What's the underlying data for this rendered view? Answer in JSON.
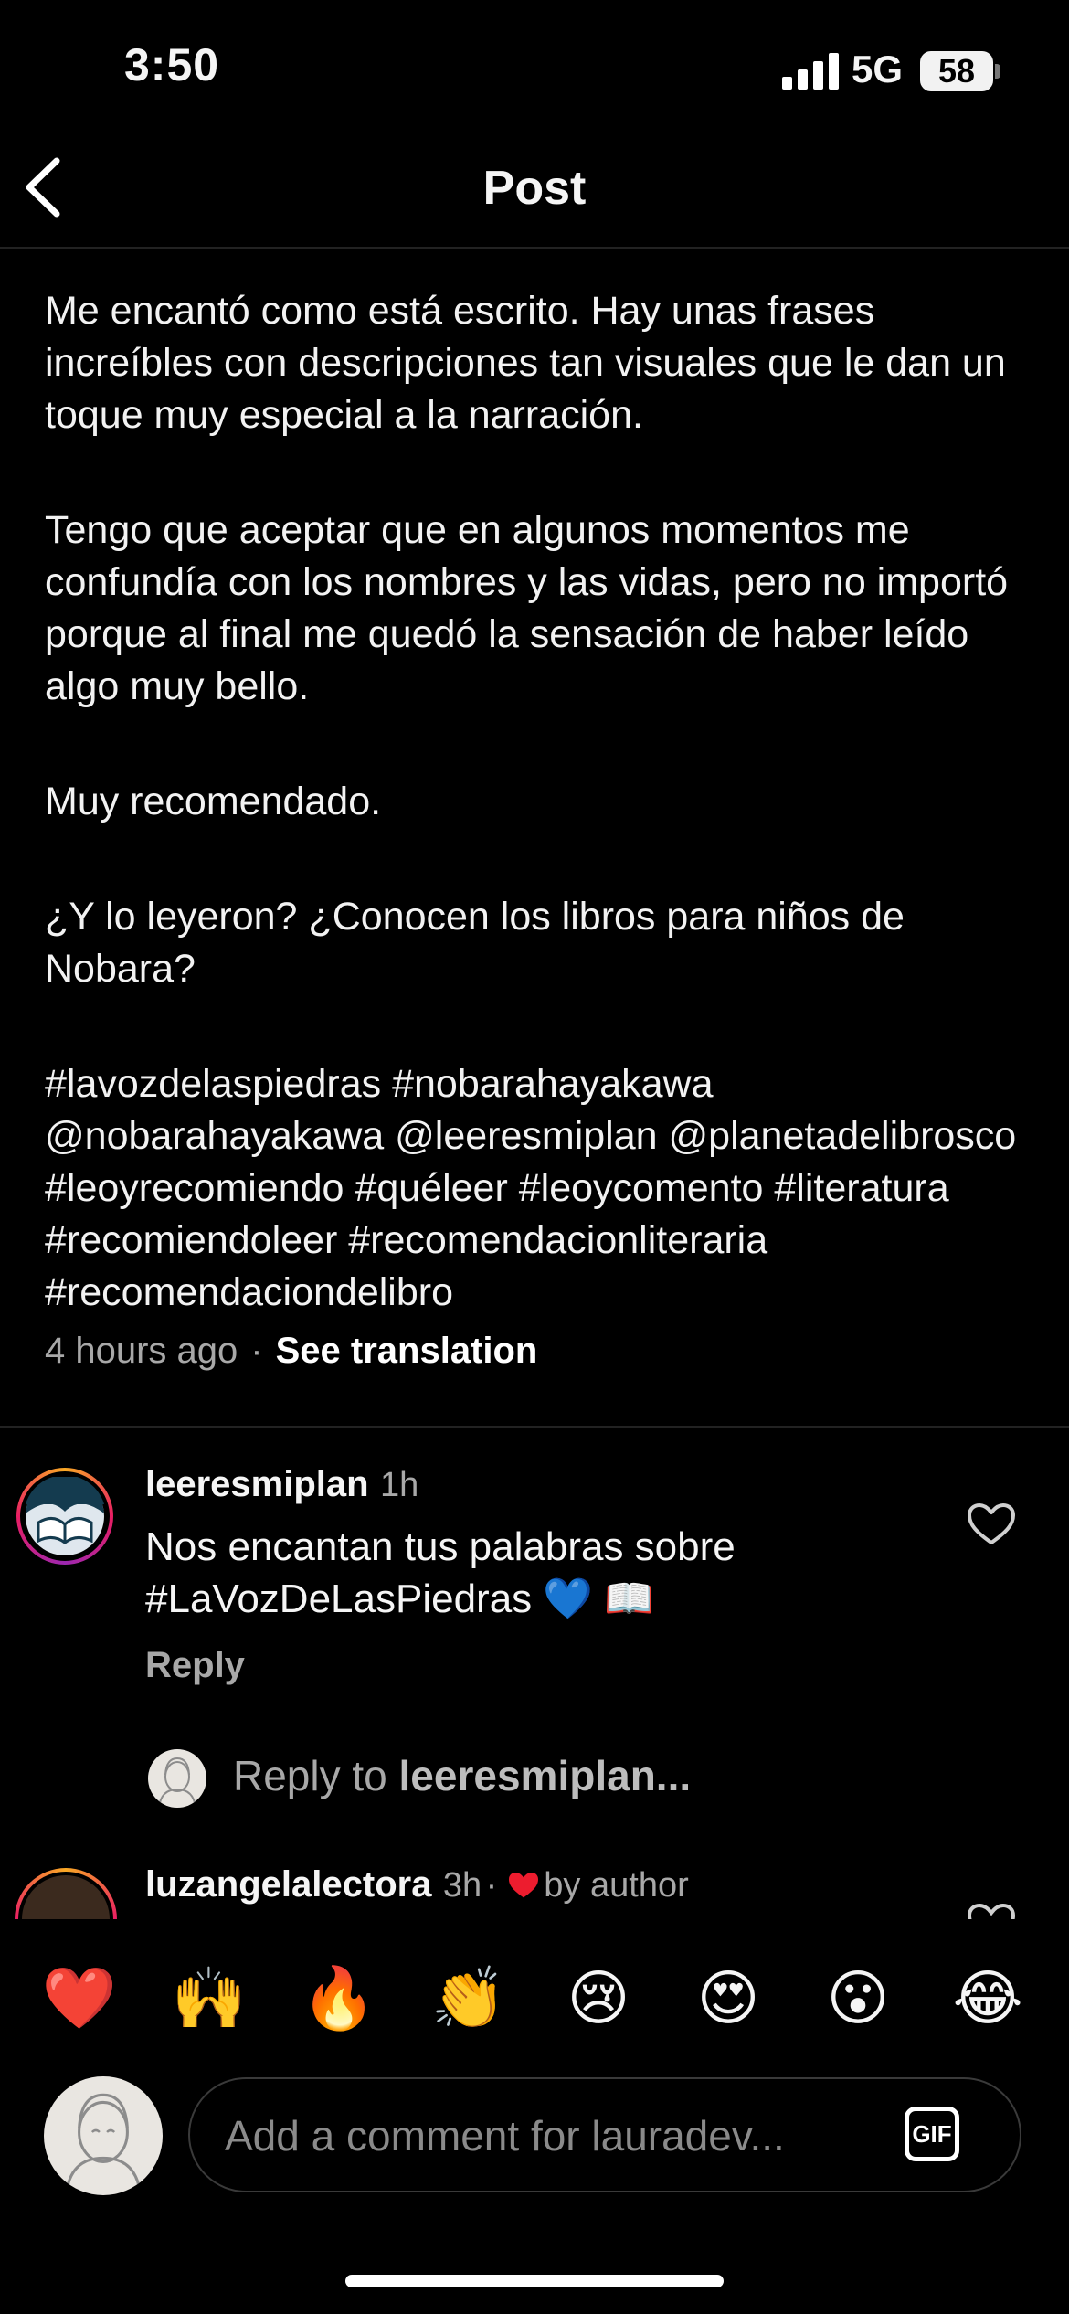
{
  "status_bar": {
    "time": "3:50",
    "network": "5G",
    "battery": "58"
  },
  "nav": {
    "title": "Post"
  },
  "caption": {
    "paragraphs": [
      "Me encantó como está escrito. Hay unas frases increíbles con descripciones tan visuales que le dan un toque muy especial a la narración.",
      "Tengo que aceptar que en algunos momentos me confundía con los nombres y las vidas, pero no importó porque al final me quedó la sensación de haber leído algo muy bello.",
      "Muy recomendado.",
      "¿Y lo leyeron? ¿Conocen los libros para niños de Nobara?"
    ],
    "tags": "#lavozdelaspiedras #nobarahayakawa @nobarahayakawa @leeresmiplan @planetadelibrosco #leoyrecomiendo #quéleer #leoycomento #literatura #recomiendoleer #recomendacionliteraria #recomendaciondelibro",
    "timestamp": "4 hours ago",
    "see_translation": "See translation"
  },
  "comments": [
    {
      "username": "leeresmiplan",
      "time": "1h",
      "text": "Nos encantan tus palabras sobre #LaVozDeLasPiedras 💙 📖",
      "reply_label": "Reply"
    },
    {
      "username": "luzangelalectora",
      "time": "3h",
      "by_author": "by author"
    }
  ],
  "reply_prompt": {
    "prefix": "Reply to ",
    "target": "leeresmiplan..."
  },
  "emoji_bar": [
    "❤️",
    "🙌",
    "🔥",
    "👏",
    "😢",
    "😍",
    "😮",
    "😂"
  ],
  "comment_input": {
    "placeholder": "Add a comment for lauradev...",
    "gif_label": "GIF"
  },
  "colors": {
    "background": "#000000",
    "text": "#f5f5f5",
    "muted": "#a8a8a8",
    "heart_red": "#ed4956",
    "sad_heart": "#2f6bff"
  }
}
